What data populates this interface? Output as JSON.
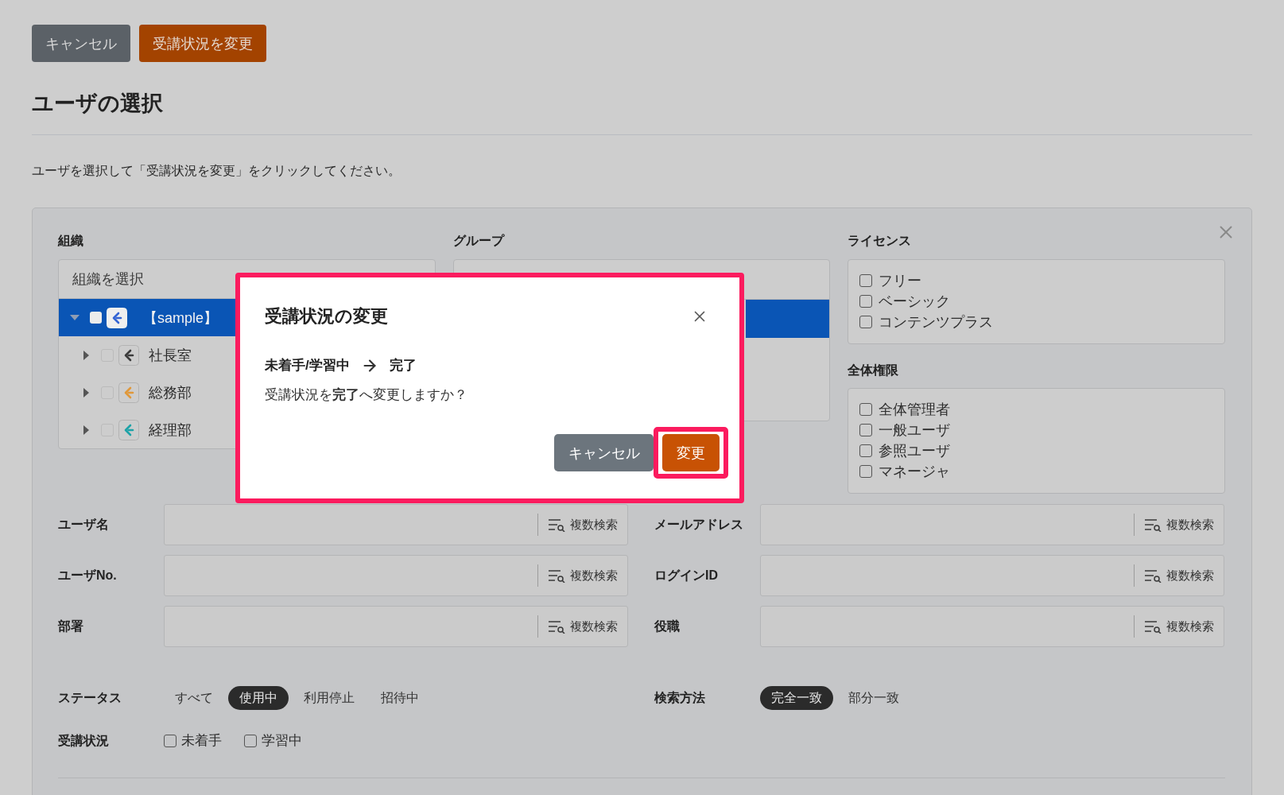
{
  "top_buttons": [
    {
      "label": "キャンセル",
      "kind": "secondary"
    },
    {
      "label": "受講状況を変更",
      "kind": "primary"
    }
  ],
  "page_title": "ユーザの選択",
  "instruction": "ユーザを選択して「受講状況を変更」をクリックしてください。",
  "filters": {
    "organization": {
      "label": "組織",
      "placeholder": "組織を選択",
      "tree": [
        {
          "label": "【sample】",
          "selected": true,
          "checked": false,
          "expanded": true,
          "color": "#3565d4",
          "children": [
            {
              "label": "社長室",
              "selected": false,
              "checked": false,
              "expanded": false,
              "color": "#3c3c3c"
            },
            {
              "label": "総務部",
              "selected": false,
              "checked": false,
              "expanded": false,
              "color": "#e0983a"
            },
            {
              "label": "経理部",
              "selected": false,
              "checked": false,
              "expanded": false,
              "color": "#1ea3a8"
            }
          ]
        }
      ]
    },
    "group": {
      "label": "グループ",
      "rows": [
        {
          "selected": true
        }
      ]
    },
    "license": {
      "label": "ライセンス",
      "options": [
        {
          "label": "フリー",
          "checked": false
        },
        {
          "label": "ベーシック",
          "checked": false
        },
        {
          "label": "コンテンツプラス",
          "checked": false
        }
      ]
    },
    "global_permission": {
      "label": "全体権限",
      "options": [
        {
          "label": "全体管理者",
          "checked": false
        },
        {
          "label": "一般ユーザ",
          "checked": false
        },
        {
          "label": "参照ユーザ",
          "checked": false
        },
        {
          "label": "マネージャ",
          "checked": false
        }
      ]
    },
    "text_fields": [
      {
        "label": "ユーザ名",
        "button": "複数検索"
      },
      {
        "label": "メールアドレス",
        "button": "複数検索"
      },
      {
        "label": "ユーザNo.",
        "button": "複数検索"
      },
      {
        "label": "ログインID",
        "button": "複数検索"
      },
      {
        "label": "部署",
        "button": "複数検索"
      },
      {
        "label": "役職",
        "button": "複数検索"
      }
    ],
    "status": {
      "label": "ステータス",
      "options": [
        {
          "label": "すべて",
          "selected": false
        },
        {
          "label": "使用中",
          "selected": true
        },
        {
          "label": "利用停止",
          "selected": false
        },
        {
          "label": "招待中",
          "selected": false
        }
      ]
    },
    "search_method": {
      "label": "検索方法",
      "options": [
        {
          "label": "完全一致",
          "selected": true
        },
        {
          "label": "部分一致",
          "selected": false
        }
      ]
    },
    "course_status": {
      "label": "受講状況",
      "options": [
        {
          "label": "未着手",
          "checked": false
        },
        {
          "label": "学習中",
          "checked": false
        }
      ]
    }
  },
  "dialog": {
    "highlighted": true,
    "title": "受講状況の変更",
    "from": "未着手/学習中",
    "to": "完了",
    "message": "受講状況を**完了**へ変更しますか？",
    "buttons": [
      {
        "label": "キャンセル",
        "kind": "secondary",
        "highlighted": false
      },
      {
        "label": "変更",
        "kind": "primary",
        "highlighted": true
      }
    ]
  }
}
